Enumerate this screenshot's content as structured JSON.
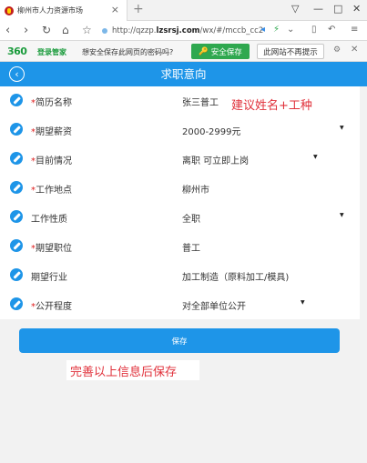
{
  "browser": {
    "tab_title": "柳州市人力资源市场",
    "tab_close": "×",
    "new_tab": "+",
    "url_prefix": "http://qzzp.",
    "url_domain": "lzsrsj.com",
    "url_path": "/wx/#/mccb_cc2"
  },
  "password_bar": {
    "logo": "360",
    "logo_sub": "登录管家",
    "question": "想安全保存此网页的密码吗?",
    "save_label": "安全保存",
    "dismiss_label": "此网站不再提示"
  },
  "page": {
    "title": "求职意向",
    "submit_label": "保存",
    "hint_name": "建议姓名+工种",
    "hint_save": "完善以上信息后保存"
  },
  "form": {
    "rows": [
      {
        "label": "简历名称",
        "required": "*",
        "value": "张三普工",
        "dropdown": ""
      },
      {
        "label": "期望薪资",
        "required": "*",
        "value": "2000-2999元",
        "dropdown": "▼"
      },
      {
        "label": "目前情况",
        "required": "*",
        "value": "离职 可立即上岗",
        "dropdown": "▼"
      },
      {
        "label": "工作地点",
        "required": "*",
        "value": "柳州市",
        "dropdown": ""
      },
      {
        "label": "工作性质",
        "required": "",
        "value": "全职",
        "dropdown": "▼"
      },
      {
        "label": "期望职位",
        "required": "*",
        "value": "普工",
        "dropdown": ""
      },
      {
        "label": "期望行业",
        "required": "",
        "value": "加工制造（原料加工/模具)",
        "dropdown": ""
      },
      {
        "label": "公开程度",
        "required": "*",
        "value": "对全部单位公开",
        "dropdown": "▼"
      }
    ]
  },
  "colors": {
    "accent": "#1e95e8",
    "required": "#e02020",
    "hint": "#e0303a",
    "brand_green": "#2fa84f"
  }
}
